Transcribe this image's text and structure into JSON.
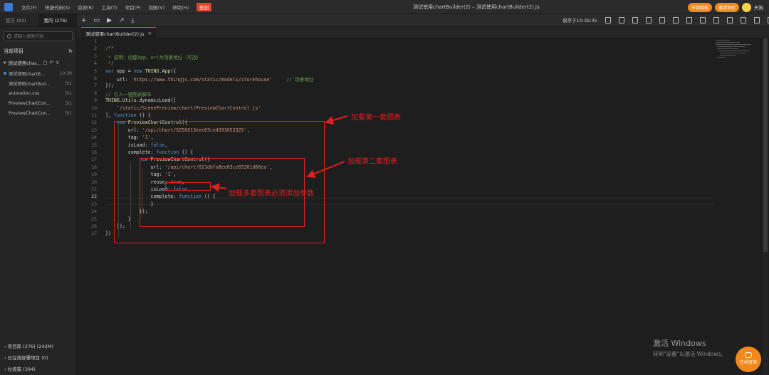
{
  "menubar": {
    "items": [
      "文件(F)",
      "快捷代码(S)",
      "资源(R)",
      "工具(T)",
      "项目(P)",
      "视图(V)",
      "帮助(H)"
    ],
    "badge": "签到",
    "window_title": "测试使用chartBuilder(2) – 测试使用chartBuilder(2).js",
    "btn_apply": "申请赋权",
    "btn_invite": "邀请协助",
    "user_name": "天狗"
  },
  "sidebar": {
    "tab_official": "官方 (83)",
    "tab_mine": "我的 (276)",
    "search_placeholder": "请输入搜索内容...",
    "current_project": "当前项目",
    "project_name": "测试使用char...",
    "files": [
      {
        "name": "测试使用chartB...",
        "date": "10:39"
      },
      {
        "name": "测试使用chartBuil...",
        "date": "3/1"
      },
      {
        "name": "animation.css",
        "date": "3/1"
      },
      {
        "name": "PreviewChartCon...",
        "date": "3/1"
      },
      {
        "name": "PreviewChartCon...",
        "date": "3/1"
      }
    ],
    "bottom": [
      "项目库 (276) (242M)",
      "已在线部署项目 (0)",
      "垃圾箱 (394)"
    ]
  },
  "toolbar": {
    "saved_text": "保存于10:39:35"
  },
  "tab": {
    "file_name": "测试使用chartBuilder(2).js",
    "close": "×"
  },
  "editor": {
    "line_numbers": [
      "1",
      "2",
      "3",
      "4",
      "5",
      "6",
      "7",
      "8",
      "9",
      "10",
      "11",
      "12",
      "13",
      "14",
      "15",
      "16",
      "17",
      "18",
      "19",
      "20",
      "21",
      "22",
      "23",
      "24",
      "25",
      "26",
      "27"
    ],
    "current_line": "22"
  },
  "annotations": {
    "first_chart": "加载第一套图表",
    "second_chart": "加载第二套图表",
    "reuse_note": "加载多套图表必须添加参数"
  },
  "watermark": {
    "line1": "激活 Windows",
    "line2": "转到\"设置\"以激活 Windows。"
  },
  "chat": {
    "label": "在线咨询"
  },
  "colors": {
    "accent_orange": "#f0891a",
    "annotation_red": "#e02020",
    "link_blue": "#3a8fdf"
  }
}
